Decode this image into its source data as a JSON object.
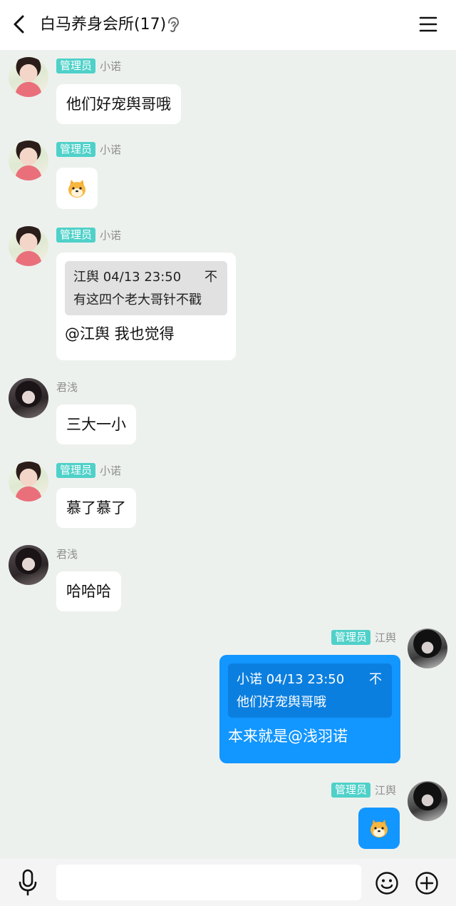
{
  "header": {
    "title": "白马养身会所(17)"
  },
  "messages": [
    {
      "sender": "小诺",
      "badge": "管理员",
      "text": "他们好宠舆哥哦"
    },
    {
      "sender": "小诺",
      "badge": "管理员",
      "emoji": "doge-sticker"
    },
    {
      "sender": "小诺",
      "badge": "管理员",
      "quote_head": "江舆 04/13 23:50",
      "quote_body": "有这四个老大哥针不戳",
      "quote_pin": "不",
      "text": "@江舆 我也觉得"
    },
    {
      "sender": "君浅",
      "text": "三大一小"
    },
    {
      "sender": "小诺",
      "badge": "管理员",
      "text": "慕了慕了"
    },
    {
      "sender": "君浅",
      "text": "哈哈哈"
    },
    {
      "sender": "江舆",
      "badge": "管理员",
      "mine": true,
      "quote_head": "小诺 04/13 23:50",
      "quote_body": "他们好宠舆哥哦",
      "quote_pin": "不",
      "text": "本来就是@浅羽诺"
    },
    {
      "sender": "江舆",
      "badge": "管理员",
      "mine": true,
      "emoji": "doge-sticker"
    }
  ],
  "input": {
    "value": ""
  },
  "colors": {
    "accent": "#1296ff",
    "badge": "#4fd1c9",
    "background": "#edf1ee"
  }
}
